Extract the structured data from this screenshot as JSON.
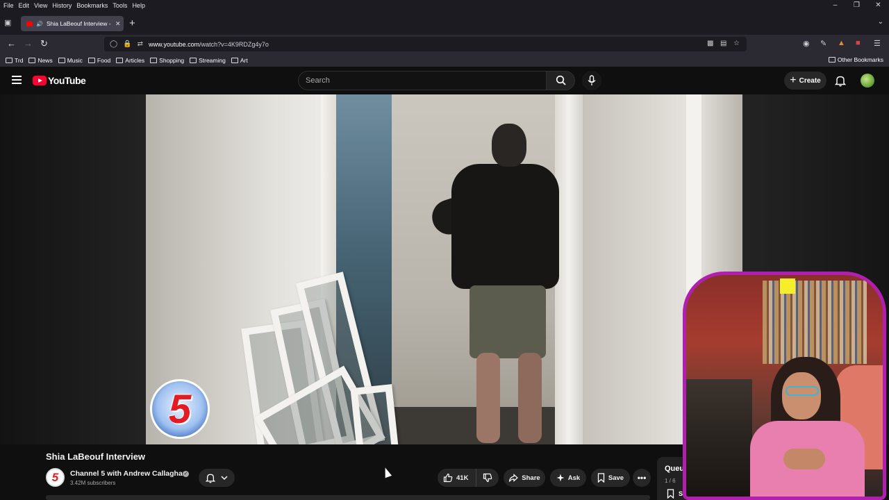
{
  "browser": {
    "menu": [
      "File",
      "Edit",
      "View",
      "History",
      "Bookmarks",
      "Tools",
      "Help"
    ],
    "tab_title": "Shia LaBeouf Interview - Yo",
    "url_domain": "www.youtube.com",
    "url_path": "/watch?v=4K9RDZg4y7o",
    "bookmarks": [
      "Trd",
      "News",
      "Music",
      "Food",
      "Articles",
      "Shopping",
      "Streaming",
      "Art"
    ],
    "other_bookmarks": "Other Bookmarks"
  },
  "youtube": {
    "logo_text": "YouTube",
    "search_placeholder": "Search",
    "create_label": "Create"
  },
  "video": {
    "title": "Shia LaBeouf Interview",
    "channel_name": "Channel 5 with Andrew Callaghan",
    "subscribers": "3.42M subscribers",
    "logo_number": "5",
    "likes": "41K",
    "share_label": "Share",
    "ask_label": "Ask",
    "save_label": "Save"
  },
  "queue": {
    "title": "Queu",
    "count": "1 / 6",
    "save_label": "Save"
  },
  "colors": {
    "yt_red": "#ff0033",
    "webcam_border": "#b01fae",
    "channel_red": "#e31b23"
  }
}
